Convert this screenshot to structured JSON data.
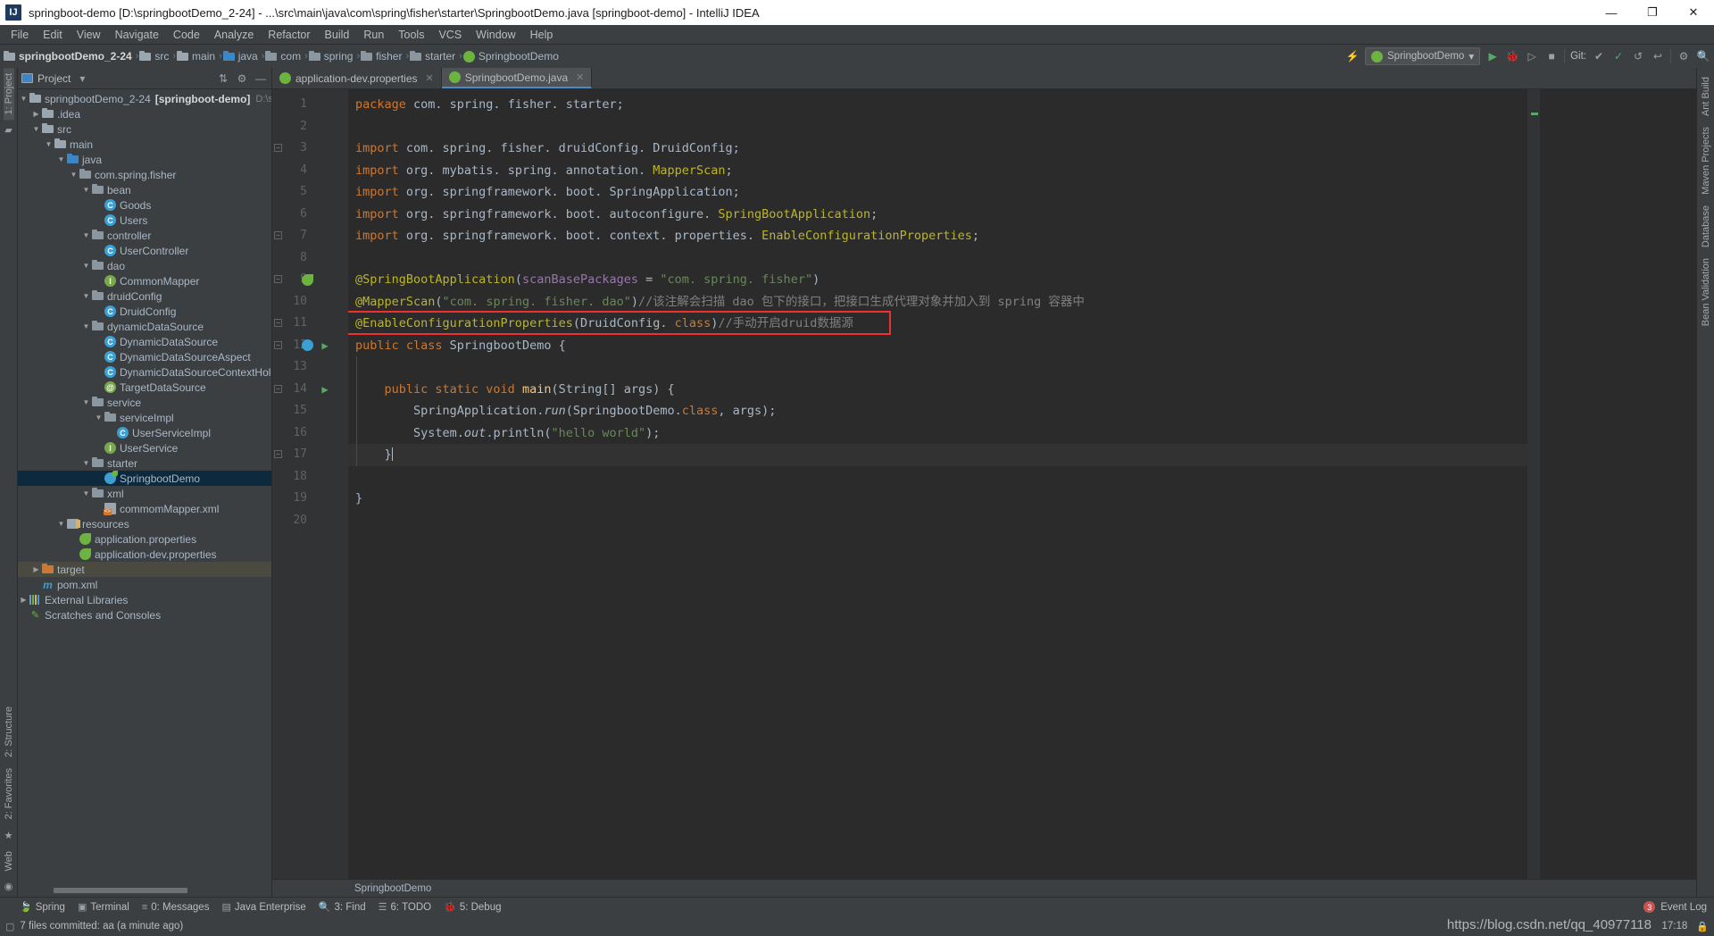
{
  "window": {
    "title": "springboot-demo [D:\\springbootDemo_2-24] - ...\\src\\main\\java\\com\\spring\\fisher\\starter\\SpringbootDemo.java [springboot-demo] - IntelliJ IDEA",
    "logo": "IJ",
    "minimize": "—",
    "maximize": "❐",
    "close": "✕"
  },
  "menubar": {
    "items": [
      "File",
      "Edit",
      "View",
      "Navigate",
      "Code",
      "Analyze",
      "Refactor",
      "Build",
      "Run",
      "Tools",
      "VCS",
      "Window",
      "Help"
    ]
  },
  "navbar": {
    "crumbs": [
      {
        "label": "springbootDemo_2-24",
        "icon": "folder-module-icon"
      },
      {
        "label": "src",
        "icon": "folder-icon"
      },
      {
        "label": "main",
        "icon": "folder-icon"
      },
      {
        "label": "java",
        "icon": "folder-source-icon"
      },
      {
        "label": "com",
        "icon": "package-icon"
      },
      {
        "label": "spring",
        "icon": "package-icon"
      },
      {
        "label": "fisher",
        "icon": "package-icon"
      },
      {
        "label": "starter",
        "icon": "package-icon"
      },
      {
        "label": "SpringbootDemo",
        "icon": "springboot-class-icon"
      }
    ],
    "separator": "›",
    "run_config": "SpringbootDemo",
    "run_config_caret": "▾",
    "git_label": "Git:",
    "icons": {
      "search_everywhere": "⚡",
      "run": "▶",
      "debug": "🐞",
      "run_with_coverage": "▷",
      "stop": "■",
      "update_project": "✔",
      "commit": "✓",
      "history": "↺",
      "rollback": "↩",
      "settings": "⚙",
      "search": "🔍"
    }
  },
  "left_rail": {
    "top": [
      "1: Project"
    ],
    "top_icon": "folder-icon",
    "bottom": [
      "2: Structure",
      "2: Favorites",
      "Web"
    ],
    "star_icon": "★"
  },
  "right_rail": {
    "items": [
      "Ant Build",
      "Maven Projects",
      "Database",
      "Bean Validation"
    ]
  },
  "project_panel": {
    "title": "Project",
    "caret": "▾",
    "collapse_all_icon": "collapse-all-icon",
    "settings_icon": "gear-icon",
    "hide_icon": "minimize-icon",
    "tree": [
      {
        "depth": 0,
        "arrow": "▼",
        "icon": "module-icon",
        "label": "springbootDemo_2-24",
        "suffix": "[springboot-demo]",
        "dim": "D:\\spring"
      },
      {
        "depth": 1,
        "arrow": "▶",
        "icon": "folder-icon",
        "label": ".idea"
      },
      {
        "depth": 1,
        "arrow": "▼",
        "icon": "folder-icon",
        "label": "src"
      },
      {
        "depth": 2,
        "arrow": "▼",
        "icon": "folder-icon",
        "label": "main"
      },
      {
        "depth": 3,
        "arrow": "▼",
        "icon": "source-root-icon",
        "label": "java"
      },
      {
        "depth": 4,
        "arrow": "▼",
        "icon": "package-icon",
        "label": "com.spring.fisher"
      },
      {
        "depth": 5,
        "arrow": "▼",
        "icon": "package-icon",
        "label": "bean"
      },
      {
        "depth": 6,
        "arrow": "",
        "icon": "class-icon",
        "label": "Goods"
      },
      {
        "depth": 6,
        "arrow": "",
        "icon": "class-icon",
        "label": "Users"
      },
      {
        "depth": 5,
        "arrow": "▼",
        "icon": "package-icon",
        "label": "controller"
      },
      {
        "depth": 6,
        "arrow": "",
        "icon": "class-icon",
        "label": "UserController"
      },
      {
        "depth": 5,
        "arrow": "▼",
        "icon": "package-icon",
        "label": "dao"
      },
      {
        "depth": 6,
        "arrow": "",
        "icon": "interface-icon",
        "label": "CommonMapper"
      },
      {
        "depth": 5,
        "arrow": "▼",
        "icon": "package-icon",
        "label": "druidConfig"
      },
      {
        "depth": 6,
        "arrow": "",
        "icon": "class-icon",
        "label": "DruidConfig"
      },
      {
        "depth": 5,
        "arrow": "▼",
        "icon": "package-icon",
        "label": "dynamicDataSource"
      },
      {
        "depth": 6,
        "arrow": "",
        "icon": "class-icon",
        "label": "DynamicDataSource"
      },
      {
        "depth": 6,
        "arrow": "",
        "icon": "class-icon",
        "label": "DynamicDataSourceAspect"
      },
      {
        "depth": 6,
        "arrow": "",
        "icon": "class-icon",
        "label": "DynamicDataSourceContextHolder"
      },
      {
        "depth": 6,
        "arrow": "",
        "icon": "annotation-icon",
        "label": "TargetDataSource"
      },
      {
        "depth": 5,
        "arrow": "▼",
        "icon": "package-icon",
        "label": "service"
      },
      {
        "depth": 6,
        "arrow": "▼",
        "icon": "package-icon",
        "label": "serviceImpl"
      },
      {
        "depth": 7,
        "arrow": "",
        "icon": "class-icon",
        "label": "UserServiceImpl"
      },
      {
        "depth": 6,
        "arrow": "",
        "icon": "interface-icon",
        "label": "UserService"
      },
      {
        "depth": 5,
        "arrow": "▼",
        "icon": "package-icon",
        "label": "starter"
      },
      {
        "depth": 6,
        "arrow": "",
        "icon": "springboot-class-icon",
        "label": "SpringbootDemo",
        "selected": true
      },
      {
        "depth": 5,
        "arrow": "▼",
        "icon": "package-icon",
        "label": "xml"
      },
      {
        "depth": 6,
        "arrow": "",
        "icon": "xml-file-icon",
        "label": "commomMapper.xml"
      },
      {
        "depth": 3,
        "arrow": "▼",
        "icon": "resources-root-icon",
        "label": "resources"
      },
      {
        "depth": 4,
        "arrow": "",
        "icon": "spring-properties-icon",
        "label": "application.properties"
      },
      {
        "depth": 4,
        "arrow": "",
        "icon": "spring-properties-icon",
        "label": "application-dev.properties"
      },
      {
        "depth": 1,
        "arrow": "▶",
        "icon": "folder-excluded-icon",
        "label": "target",
        "highlighted": true
      },
      {
        "depth": 1,
        "arrow": "",
        "icon": "maven-pom-icon",
        "label": "pom.xml"
      },
      {
        "depth": 0,
        "arrow": "▶",
        "icon": "libraries-icon",
        "label": "External Libraries"
      },
      {
        "depth": 0,
        "arrow": "",
        "icon": "scratches-icon",
        "label": "Scratches and Consoles"
      }
    ]
  },
  "editor": {
    "tabs": [
      {
        "label": "application-dev.properties",
        "icon": "spring-properties-icon",
        "active": false,
        "close": "✕"
      },
      {
        "label": "SpringbootDemo.java",
        "icon": "springboot-class-icon",
        "active": true,
        "close": "✕"
      }
    ],
    "breadcrumb_bottom": "SpringbootDemo",
    "line_numbers": [
      "1",
      "2",
      "3",
      "4",
      "5",
      "6",
      "7",
      "8",
      "9",
      "10",
      "11",
      "12",
      "13",
      "14",
      "15",
      "16",
      "17",
      "18",
      "19",
      "20"
    ],
    "code_lines": [
      {
        "n": 1,
        "tokens": [
          {
            "t": "package ",
            "c": "k"
          },
          {
            "t": "com. spring. fisher. starter",
            "c": "cls"
          },
          {
            "t": ";",
            "c": "cls"
          }
        ]
      },
      {
        "n": 2,
        "tokens": []
      },
      {
        "n": 3,
        "tokens": [
          {
            "t": "import ",
            "c": "k"
          },
          {
            "t": "com. spring. fisher. druidConfig. DruidConfig;",
            "c": "cls"
          }
        ]
      },
      {
        "n": 4,
        "tokens": [
          {
            "t": "import ",
            "c": "k"
          },
          {
            "t": "org. mybatis. spring. annotation. ",
            "c": "cls"
          },
          {
            "t": "MapperScan",
            "c": "ann"
          },
          {
            "t": ";",
            "c": "cls"
          }
        ]
      },
      {
        "n": 5,
        "tokens": [
          {
            "t": "import ",
            "c": "k"
          },
          {
            "t": "org. springframework. boot. SpringApplication;",
            "c": "cls"
          }
        ]
      },
      {
        "n": 6,
        "tokens": [
          {
            "t": "import ",
            "c": "k"
          },
          {
            "t": "org. springframework. boot. autoconfigure. ",
            "c": "cls"
          },
          {
            "t": "SpringBootApplication",
            "c": "ann"
          },
          {
            "t": ";",
            "c": "cls"
          }
        ]
      },
      {
        "n": 7,
        "tokens": [
          {
            "t": "import ",
            "c": "k"
          },
          {
            "t": "org. springframework. boot. context. properties. ",
            "c": "cls"
          },
          {
            "t": "EnableConfigurationProperties",
            "c": "ann"
          },
          {
            "t": ";",
            "c": "cls"
          }
        ]
      },
      {
        "n": 8,
        "tokens": []
      },
      {
        "n": 9,
        "tokens": [
          {
            "t": "@SpringBootApplication",
            "c": "ann"
          },
          {
            "t": "(",
            "c": "cls"
          },
          {
            "t": "scanBasePackages",
            "c": "fld"
          },
          {
            "t": " = ",
            "c": "cls"
          },
          {
            "t": "\"com. spring. fisher\"",
            "c": "str"
          },
          {
            "t": ")",
            "c": "cls"
          }
        ]
      },
      {
        "n": 10,
        "tokens": [
          {
            "t": "@MapperScan",
            "c": "ann"
          },
          {
            "t": "(",
            "c": "cls"
          },
          {
            "t": "\"com. spring. fisher. dao\"",
            "c": "str"
          },
          {
            "t": ")",
            "c": "cls"
          },
          {
            "t": "//该注解会扫描 dao 包下的接口，把接口生成代理对象并加入到 spring 容器中",
            "c": "cmt"
          }
        ]
      },
      {
        "n": 11,
        "tokens": [
          {
            "t": "@EnableConfigurationProperties",
            "c": "ann"
          },
          {
            "t": "(",
            "c": "cls"
          },
          {
            "t": "DruidConfig. ",
            "c": "cls"
          },
          {
            "t": "class",
            "c": "k"
          },
          {
            "t": ")",
            "c": "cls"
          },
          {
            "t": "//手动开启druid数据源",
            "c": "cmt"
          }
        ],
        "boxed": true
      },
      {
        "n": 12,
        "tokens": [
          {
            "t": "public class ",
            "c": "k"
          },
          {
            "t": "SpringbootDemo ",
            "c": "cls"
          },
          {
            "t": "{",
            "c": "cls"
          }
        ]
      },
      {
        "n": 13,
        "tokens": []
      },
      {
        "n": 14,
        "tokens": [
          {
            "t": "    public static void ",
            "c": "k"
          },
          {
            "t": "main",
            "c": "mth"
          },
          {
            "t": "(String[] args) ",
            "c": "cls"
          },
          {
            "t": "{",
            "c": "cls"
          }
        ]
      },
      {
        "n": 15,
        "tokens": [
          {
            "t": "        SpringApplication.",
            "c": "cls"
          },
          {
            "t": "run",
            "c": "stat"
          },
          {
            "t": "(SpringbootDemo.",
            "c": "cls"
          },
          {
            "t": "class",
            "c": "k"
          },
          {
            "t": ", args);",
            "c": "cls"
          }
        ]
      },
      {
        "n": 16,
        "tokens": [
          {
            "t": "        System.",
            "c": "cls"
          },
          {
            "t": "out",
            "c": "stat"
          },
          {
            "t": ".println(",
            "c": "cls"
          },
          {
            "t": "\"hello world\"",
            "c": "str"
          },
          {
            "t": ");",
            "c": "cls"
          }
        ]
      },
      {
        "n": 17,
        "tokens": [
          {
            "t": "    }",
            "c": "cls"
          }
        ],
        "caret": true,
        "current": true
      },
      {
        "n": 18,
        "tokens": []
      },
      {
        "n": 19,
        "tokens": [
          {
            "t": "}",
            "c": "cls"
          }
        ]
      },
      {
        "n": 20,
        "tokens": []
      }
    ],
    "gutter_marks": [
      {
        "line": 9,
        "icon": "spring-bean-icon"
      },
      {
        "line": 12,
        "icon": "spring-boot-gutter-icon"
      },
      {
        "line": 12,
        "icon": "run-gutter-icon"
      },
      {
        "line": 14,
        "icon": "run-gutter-icon"
      }
    ]
  },
  "bottom_toolwindows": {
    "items": [
      {
        "label": "Spring",
        "icon": "spring-leaf-icon",
        "mnemonic": ""
      },
      {
        "label": "Terminal",
        "icon": "terminal-icon",
        "mnemonic": ""
      },
      {
        "label": "0: Messages",
        "icon": "messages-icon",
        "mnemonic": "0"
      },
      {
        "label": "Java Enterprise",
        "icon": "java-enterprise-icon",
        "mnemonic": ""
      },
      {
        "label": "3: Find",
        "icon": "search-icon",
        "mnemonic": "3"
      },
      {
        "label": "6: TODO",
        "icon": "todo-icon",
        "mnemonic": "6"
      },
      {
        "label": "5: Debug",
        "icon": "debug-icon",
        "mnemonic": "5"
      }
    ],
    "event_log": {
      "label": "Event Log",
      "count": "3"
    }
  },
  "statusbar": {
    "message": "7 files committed: aa (a minute ago)",
    "icon": "commit-icon",
    "position": "17:18",
    "watermark": "https://blog.csdn.net/qq_40977118"
  }
}
